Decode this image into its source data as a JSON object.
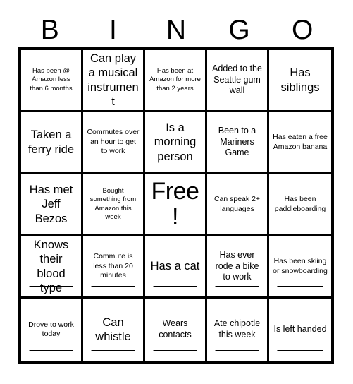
{
  "card": {
    "title_letters": [
      "B",
      "I",
      "N",
      "G",
      "O"
    ],
    "colors": {
      "ink": "#000000",
      "paper": "#ffffff",
      "grid_line": "#000000"
    },
    "grid_size": "5x5",
    "free_space_index": 12,
    "cells": [
      {
        "text": "Has been @ Amazon less than 6 months",
        "size": "fs-xs",
        "free": false,
        "signature_line": true
      },
      {
        "text": "Can play a musical instrument",
        "size": "fs-lg",
        "free": false,
        "signature_line": true
      },
      {
        "text": "Has been at Amazon for more than 2 years",
        "size": "fs-xs",
        "free": false,
        "signature_line": true
      },
      {
        "text": "Added to the Seattle gum wall",
        "size": "fs-md",
        "free": false,
        "signature_line": true
      },
      {
        "text": "Has siblings",
        "size": "fs-lg",
        "free": false,
        "signature_line": true
      },
      {
        "text": "Taken a ferry ride",
        "size": "fs-lg",
        "free": false,
        "signature_line": true
      },
      {
        "text": "Commutes over an hour to get to work",
        "size": "fs-sm",
        "free": false,
        "signature_line": true
      },
      {
        "text": "Is a morning person",
        "size": "fs-lg",
        "free": false,
        "signature_line": true
      },
      {
        "text": "Been to a Mariners Game",
        "size": "fs-md",
        "free": false,
        "signature_line": true
      },
      {
        "text": "Has eaten a free Amazon banana",
        "size": "fs-sm",
        "free": false,
        "signature_line": true
      },
      {
        "text": "Has met Jeff Bezos",
        "size": "fs-lg",
        "free": false,
        "signature_line": true
      },
      {
        "text": "Bought something from Amazon this week",
        "size": "fs-xs",
        "free": false,
        "signature_line": true
      },
      {
        "text": "Free!",
        "size": "fs-free",
        "free": true,
        "signature_line": false
      },
      {
        "text": "Can speak 2+ languages",
        "size": "fs-sm",
        "free": false,
        "signature_line": true
      },
      {
        "text": "Has been paddleboarding",
        "size": "fs-sm",
        "free": false,
        "signature_line": true
      },
      {
        "text": "Knows their blood type",
        "size": "fs-lg",
        "free": false,
        "signature_line": true
      },
      {
        "text": "Commute is less than 20 minutes",
        "size": "fs-sm",
        "free": false,
        "signature_line": true
      },
      {
        "text": "Has a cat",
        "size": "fs-lg",
        "free": false,
        "signature_line": true
      },
      {
        "text": "Has ever rode a bike to work",
        "size": "fs-md",
        "free": false,
        "signature_line": true
      },
      {
        "text": "Has been skiing or snowboarding",
        "size": "fs-sm",
        "free": false,
        "signature_line": true
      },
      {
        "text": "Drove to work today",
        "size": "fs-sm",
        "free": false,
        "signature_line": true
      },
      {
        "text": "Can whistle",
        "size": "fs-lg",
        "free": false,
        "signature_line": true
      },
      {
        "text": "Wears contacts",
        "size": "fs-md",
        "free": false,
        "signature_line": true
      },
      {
        "text": "Ate chipotle this week",
        "size": "fs-md",
        "free": false,
        "signature_line": true
      },
      {
        "text": "Is left handed",
        "size": "fs-md",
        "free": false,
        "signature_line": true
      }
    ]
  }
}
